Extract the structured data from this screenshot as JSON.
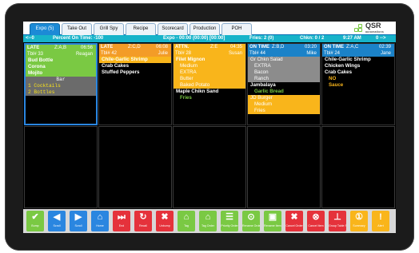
{
  "tabs": [
    {
      "label": "Expo (5)",
      "active": true
    },
    {
      "label": "Take Out"
    },
    {
      "label": "Grill Spy"
    },
    {
      "label": "Recipe"
    },
    {
      "label": "Scorecard"
    },
    {
      "label": "Production"
    },
    {
      "label": "POH"
    }
  ],
  "logo": {
    "text": "QSR",
    "sub": "automations"
  },
  "status": {
    "left_arrow": "<--0",
    "percent_on_time": "Percent On Time: -100",
    "expo": "Expo  - 00:00  (00:00)  [00:00]",
    "fries": "Fries: 2  (0)",
    "chkn": "Chkn: 0 / 2",
    "clock": "9:27 AM",
    "right_arrow": "0 -->"
  },
  "colors": {
    "green": "#7ac943",
    "orange": "#f39c27",
    "amber": "#f9b51b",
    "blue": "#1b82c8",
    "grey": "#8c8c8c",
    "teal": "#17b3c9"
  },
  "tickets": [
    {
      "status": "LATE",
      "code": "Z:A,B",
      "time": "06:56",
      "table": "Tbl# 33",
      "server": "Reagan",
      "items": [
        {
          "text": "Bud Bottle"
        },
        {
          "text": "Corona"
        },
        {
          "text": "Mojito"
        }
      ],
      "bar_label": "Bar",
      "bar_lines": [
        "1 Cocktails",
        "2 Bottles"
      ]
    },
    {
      "status": "LATE",
      "code": "Z:C,D",
      "time": "06:08",
      "table": "Tbl# 42",
      "server": "Julie",
      "items": [
        {
          "text": "Chile-Garlic Shrimp"
        },
        {
          "text": "Crab Cakes"
        },
        {
          "text": "Stuffed Peppers"
        }
      ]
    },
    {
      "status": "ATTN.",
      "code": "Z:E",
      "time": "04:35",
      "table": "Tbl# 28",
      "server": "Susan",
      "items": [
        {
          "text": "Filet Mignon"
        },
        {
          "text": "Medium"
        },
        {
          "text": "EXTRA"
        },
        {
          "text": "Butter"
        },
        {
          "text": "Baked Potato"
        },
        {
          "text": "Maple Chikn Sand"
        },
        {
          "text": "Fries"
        }
      ]
    },
    {
      "status": "ON TIME",
      "code": "Z:B,D",
      "time": "03:20",
      "table": "Tbl# 44",
      "server": "Mike",
      "items": [
        {
          "text": "Gr Chkn Salad"
        },
        {
          "text": "EXTRA"
        },
        {
          "text": "Bacon"
        },
        {
          "text": "Ranch"
        },
        {
          "text": "Jambalaya"
        },
        {
          "text": "Garlic Bread"
        },
        {
          "text": "JD Burger"
        },
        {
          "text": "Medium"
        },
        {
          "text": "Fries"
        }
      ]
    },
    {
      "status": "ON TIME",
      "code": "Z:A,C",
      "time": "02:39",
      "table": "Tbl# 24",
      "server": "Jane",
      "items": [
        {
          "text": "Chile-Garlic Shrimp"
        },
        {
          "text": "Chicken Wings"
        },
        {
          "text": "Crab Cakes"
        },
        {
          "text": "NO"
        },
        {
          "text": "Sauce"
        }
      ]
    }
  ],
  "toolbar": [
    {
      "label": "Bump",
      "icon": "check-icon"
    },
    {
      "label": "Scroll",
      "icon": "arrow-left-icon"
    },
    {
      "label": "Scroll",
      "icon": "arrow-right-icon"
    },
    {
      "label": "Home",
      "icon": "home-icon"
    },
    {
      "label": "End",
      "icon": "end-icon"
    },
    {
      "label": "Recall",
      "icon": "recall-icon"
    },
    {
      "label": "Unbump",
      "icon": "close-icon"
    },
    {
      "label": "Tag",
      "icon": "tag-icon"
    },
    {
      "label": "Tag Order",
      "icon": "tag-order-icon"
    },
    {
      "label": "Priority Order",
      "icon": "priority-icon"
    },
    {
      "label": "Rename Order",
      "icon": "rename-icon"
    },
    {
      "label": "Rename Item Name",
      "icon": "rename-item-icon"
    },
    {
      "label": "Cancel Order",
      "icon": "cancel-order-icon"
    },
    {
      "label": "Cancel Item",
      "icon": "cancel-item-icon"
    },
    {
      "label": "Group Table Summ",
      "icon": "group-icon"
    },
    {
      "label": "Summary",
      "icon": "summary-icon"
    },
    {
      "label": "Alert",
      "icon": "alert-icon"
    }
  ]
}
